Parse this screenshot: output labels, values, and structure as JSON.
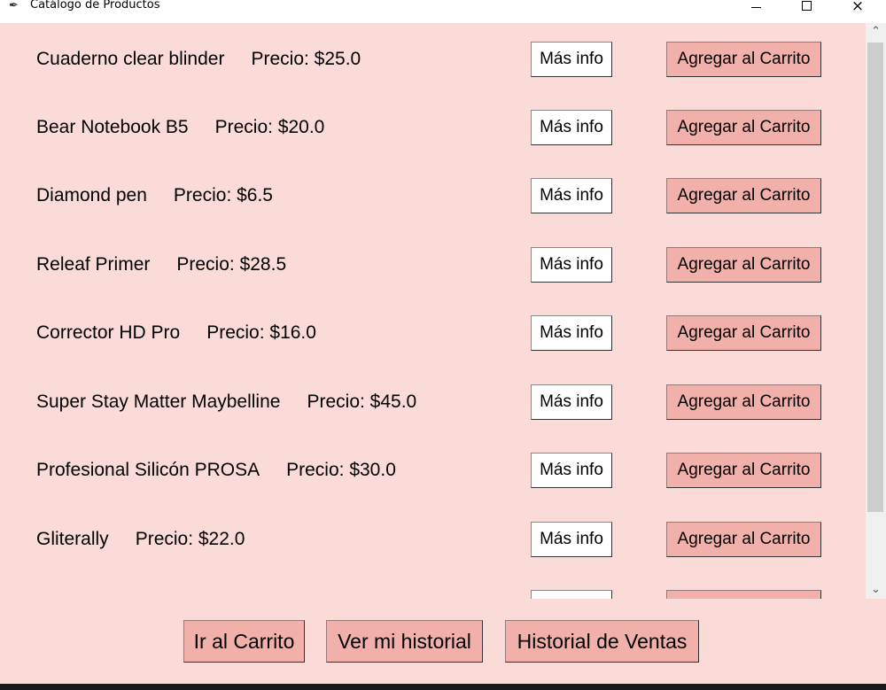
{
  "window": {
    "title": "Catálogo de Productos",
    "icon": "feather-icon",
    "controls": {
      "minimize": "minimize-icon",
      "maximize": "maximize-icon",
      "close": "×"
    }
  },
  "products": [
    {
      "name": "Cuaderno clear blinder",
      "price": "Precio: $25.0",
      "info_label": "Más info",
      "add_label": "Agregar al Carrito"
    },
    {
      "name": "Bear Notebook B5",
      "price": "Precio: $20.0",
      "info_label": "Más info",
      "add_label": "Agregar al Carrito"
    },
    {
      "name": "Diamond pen",
      "price": "Precio: $6.5",
      "info_label": "Más info",
      "add_label": "Agregar al Carrito"
    },
    {
      "name": "Releaf Primer",
      "price": "Precio: $28.5",
      "info_label": "Más info",
      "add_label": "Agregar al Carrito"
    },
    {
      "name": "Corrector HD Pro",
      "price": "Precio: $16.0",
      "info_label": "Más info",
      "add_label": "Agregar al Carrito"
    },
    {
      "name": "Super Stay Matter Maybelline",
      "price": "Precio: $45.0",
      "info_label": "Más info",
      "add_label": "Agregar al Carrito"
    },
    {
      "name": "Profesional Silicón PROSA",
      "price": "Precio: $30.0",
      "info_label": "Más info",
      "add_label": "Agregar al Carrito"
    },
    {
      "name": "Gliterally",
      "price": "Precio: $22.0",
      "info_label": "Más info",
      "add_label": "Agregar al Carrito"
    },
    {
      "name": "",
      "price": "",
      "info_label": "",
      "add_label": ""
    }
  ],
  "scrollbar": {
    "up_arrow": "⌃",
    "down_arrow": "⌄"
  },
  "footer": {
    "cart_label": "Ir al Carrito",
    "history_label": "Ver mi historial",
    "sales_label": "Historial de Ventas"
  },
  "colors": {
    "background": "#fadbd8",
    "add_button": "#f1b0aa",
    "info_button": "#ffffff"
  }
}
